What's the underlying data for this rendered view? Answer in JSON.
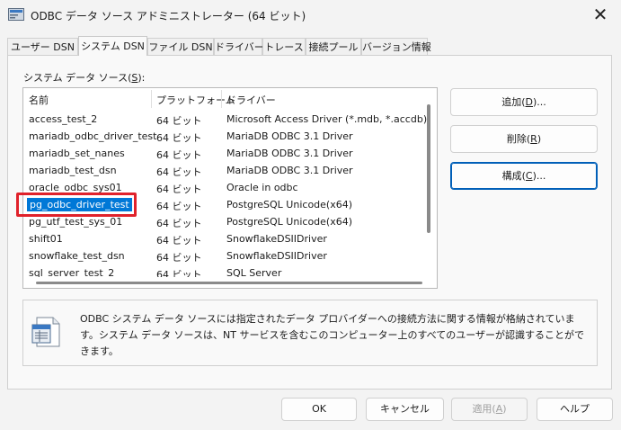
{
  "window": {
    "title": "ODBC データ ソース アドミニストレーター (64 ビット)",
    "close_glyph": "✕"
  },
  "tabs": [
    {
      "label": "ユーザー DSN"
    },
    {
      "label": "システム DSN",
      "active": true
    },
    {
      "label": "ファイル DSN"
    },
    {
      "label": "ドライバー"
    },
    {
      "label": "トレース"
    },
    {
      "label": "接続プール"
    },
    {
      "label": "バージョン情報"
    }
  ],
  "system_dsn": {
    "list_label_prefix": "システム データ ソース(",
    "list_label_key": "S",
    "list_label_suffix": "):",
    "columns": {
      "name": "名前",
      "platform": "プラットフォーム",
      "driver": "ドライバー"
    },
    "rows": [
      {
        "name": "access_test_2",
        "platform": "64 ビット",
        "driver": "Microsoft Access Driver (*.mdb, *.accdb)"
      },
      {
        "name": "mariadb_odbc_driver_test",
        "platform": "64 ビット",
        "driver": "MariaDB ODBC 3.1 Driver"
      },
      {
        "name": "mariadb_set_nanes",
        "platform": "64 ビット",
        "driver": "MariaDB ODBC 3.1 Driver"
      },
      {
        "name": "mariadb_test_dsn",
        "platform": "64 ビット",
        "driver": "MariaDB ODBC 3.1 Driver"
      },
      {
        "name": "oracle_odbc_sys01",
        "platform": "64 ビット",
        "driver": "Oracle in odbc"
      },
      {
        "name": "pg_odbc_driver_test",
        "platform": "64 ビット",
        "driver": "PostgreSQL Unicode(x64)",
        "selected": true
      },
      {
        "name": "pg_utf_test_sys_01",
        "platform": "64 ビット",
        "driver": "PostgreSQL Unicode(x64)"
      },
      {
        "name": "shift01",
        "platform": "64 ビット",
        "driver": "SnowflakeDSIIDriver"
      },
      {
        "name": "snowflake_test_dsn",
        "platform": "64 ビット",
        "driver": "SnowflakeDSIIDriver"
      },
      {
        "name": "sql_server_test_2",
        "platform": "64 ビット",
        "driver": "SQL Server"
      }
    ],
    "buttons": {
      "add": {
        "label": "追加(",
        "key": "D",
        "suffix": ")..."
      },
      "remove": {
        "label": "削除(",
        "key": "R",
        "suffix": ")"
      },
      "configure": {
        "label": "構成(",
        "key": "C",
        "suffix": ")..."
      }
    },
    "info_text": "ODBC システム データ ソースには指定されたデータ プロバイダーへの接続方法に関する情報が格納されています。システム データ ソースは、NT サービスを含むこのコンピューター上のすべてのユーザーが認識することができます。"
  },
  "footer": {
    "ok": "OK",
    "cancel": "キャンセル",
    "apply_prefix": "適用(",
    "apply_key": "A",
    "apply_suffix": ")",
    "help": "ヘルプ"
  },
  "colors": {
    "accent": "#0078d7",
    "highlight": "#e0222b"
  }
}
